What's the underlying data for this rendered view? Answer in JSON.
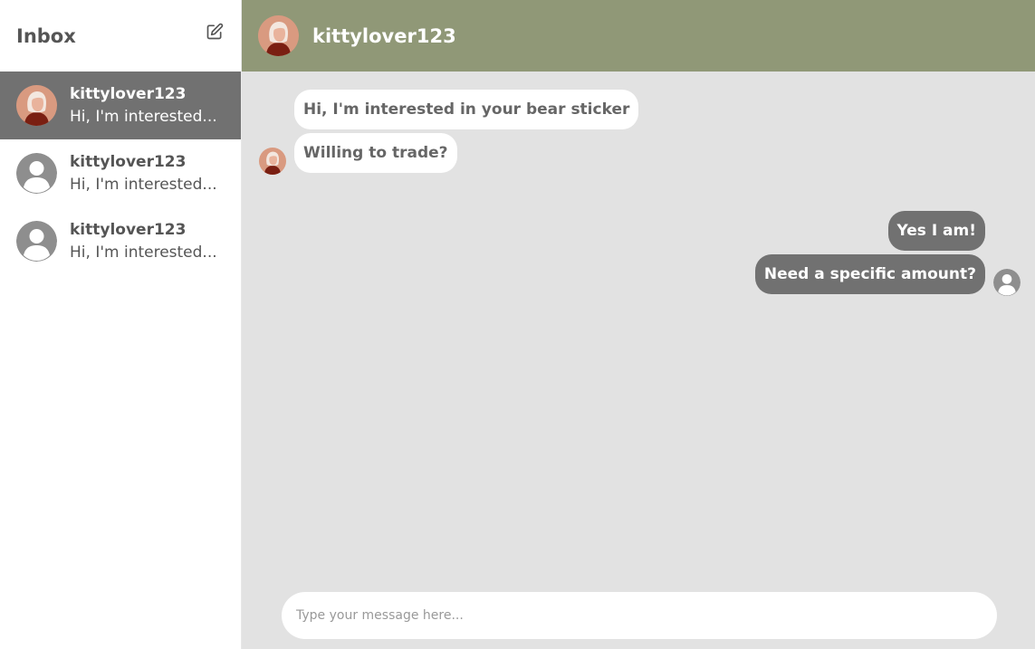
{
  "sidebar": {
    "title": "Inbox",
    "compose_icon": "edit-icon",
    "conversations": [
      {
        "name": "kittylover123",
        "preview": "Hi, I'm interested...",
        "active": true,
        "avatar": "user-photo-avatar"
      },
      {
        "name": "kittylover123",
        "preview": "Hi, I'm interested...",
        "active": false,
        "avatar": "default-user-avatar"
      },
      {
        "name": "kittylover123",
        "preview": "Hi, I'm interested...",
        "active": false,
        "avatar": "default-user-avatar"
      }
    ]
  },
  "chat": {
    "header_name": "kittylover123",
    "incoming": [
      "Hi, I'm interested in your bear sticker",
      "Willing to trade?"
    ],
    "outgoing": [
      "Yes I am!",
      "Need a specific amount?"
    ],
    "input_placeholder": "Type your message here..."
  },
  "colors": {
    "header_bg": "#909877",
    "active_conv_bg": "#717171",
    "chat_bg": "#e2e2e2",
    "outgoing_bubble": "#717171",
    "incoming_bubble": "#ffffff"
  }
}
